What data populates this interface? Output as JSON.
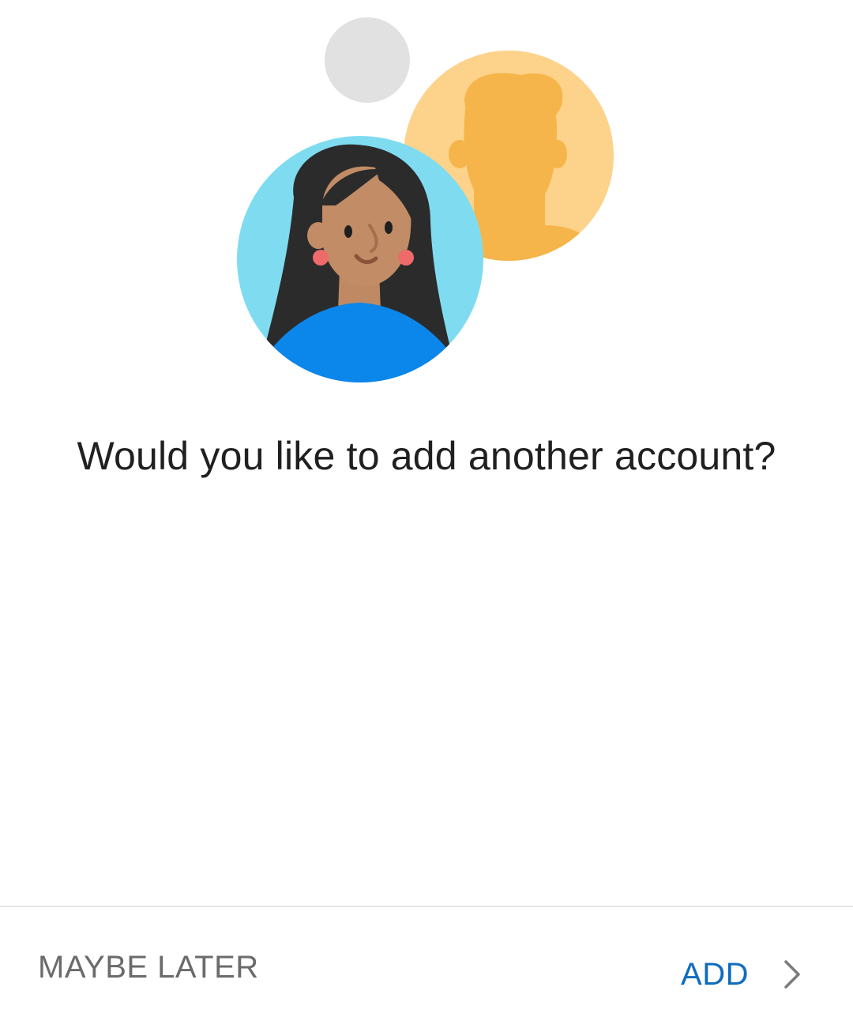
{
  "dialog": {
    "headline": "Would you like to add another account?"
  },
  "footer": {
    "secondary_label": "MAYBE LATER",
    "primary_label": "ADD",
    "primary_icon": "chevron-right-icon"
  },
  "colors": {
    "accent": "#0f6cbd",
    "secondary_text": "#6b6b6b",
    "headline_text": "#202020"
  }
}
